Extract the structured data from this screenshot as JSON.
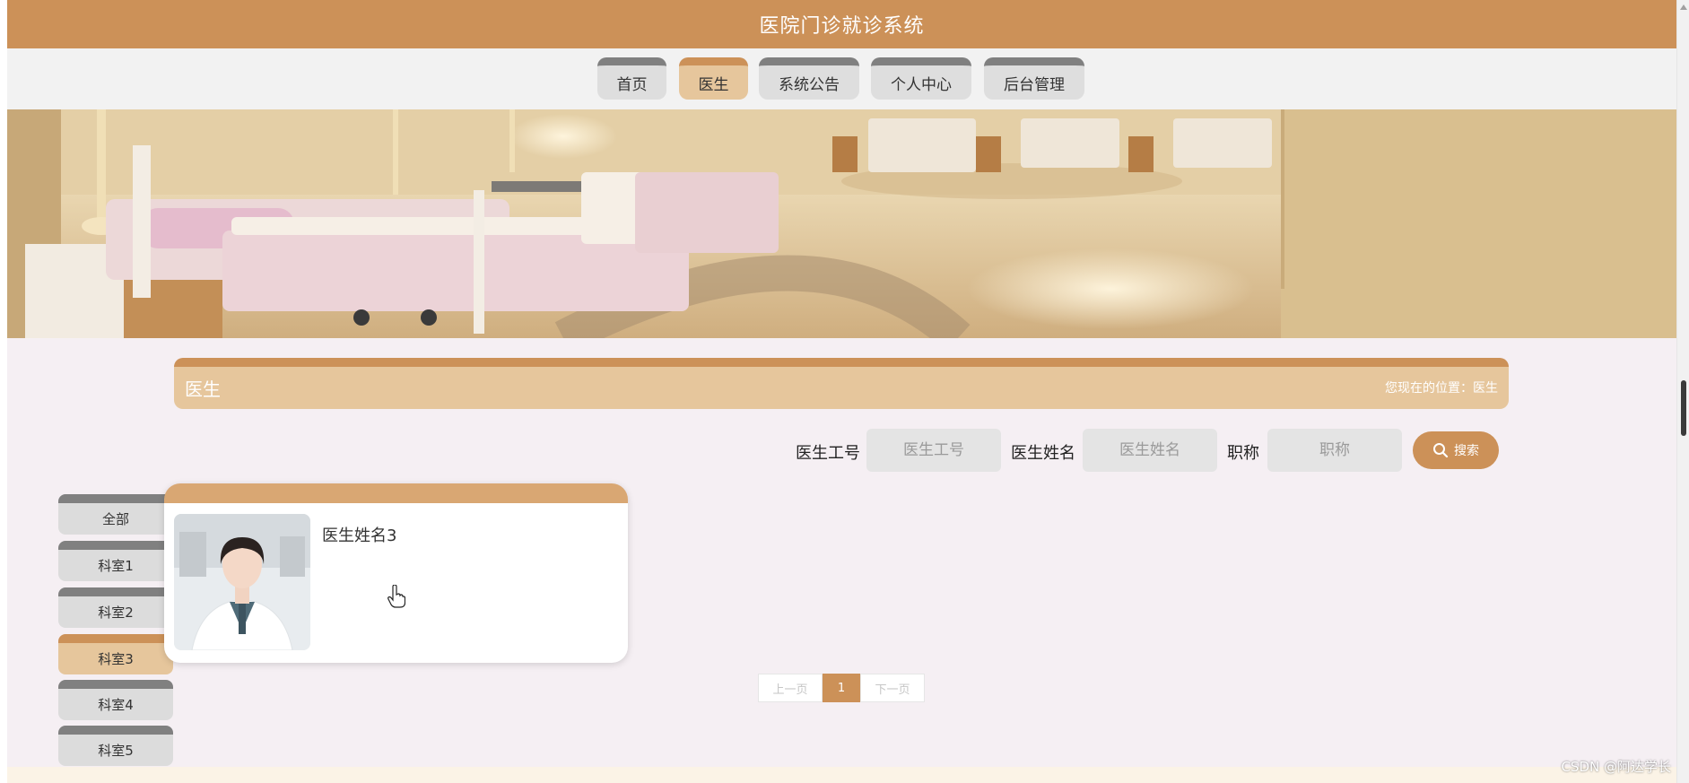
{
  "app": {
    "title": "医院门诊就诊系统"
  },
  "nav": {
    "items": [
      {
        "label": "首页",
        "active": false
      },
      {
        "label": "医生",
        "active": true
      },
      {
        "label": "系统公告",
        "active": false
      },
      {
        "label": "个人中心",
        "active": false
      },
      {
        "label": "后台管理",
        "active": false
      }
    ]
  },
  "section": {
    "title": "医生",
    "breadcrumb_prefix": "您现在的位置：",
    "breadcrumb_current": "医生"
  },
  "search": {
    "fields": [
      {
        "label": "医生工号",
        "placeholder": "医生工号",
        "value": ""
      },
      {
        "label": "医生姓名",
        "placeholder": "医生姓名",
        "value": ""
      },
      {
        "label": "职称",
        "placeholder": "职称",
        "value": ""
      }
    ],
    "button_label": "搜索",
    "button_icon": "search-icon"
  },
  "categories": {
    "items": [
      {
        "label": "全部",
        "active": false
      },
      {
        "label": "科室1",
        "active": false
      },
      {
        "label": "科室2",
        "active": false
      },
      {
        "label": "科室3",
        "active": true
      },
      {
        "label": "科室4",
        "active": false
      },
      {
        "label": "科室5",
        "active": false
      }
    ]
  },
  "doctors": [
    {
      "name": "医生姓名3"
    }
  ],
  "pagination": {
    "prev": "上一页",
    "current": "1",
    "next": "下一页"
  },
  "watermark": "CSDN @阿达学长",
  "colors": {
    "accent": "#cc9158",
    "accent_light": "#e6c69c",
    "tab_border": "#808080",
    "tab_bg": "#dedede",
    "page_bg": "#f5eff3"
  }
}
